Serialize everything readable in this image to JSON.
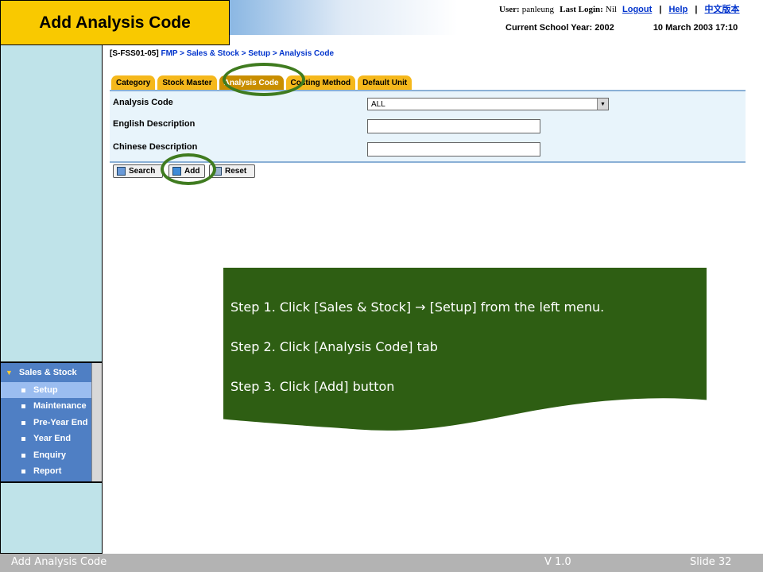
{
  "slide": {
    "title": "Add Analysis Code"
  },
  "header": {
    "user_label": "User:",
    "user_value": "panleung",
    "last_login_label": "Last Login:",
    "last_login_value": "Nil",
    "links": {
      "logout": "Logout",
      "help": "Help",
      "chinese": "中文版本"
    },
    "separator": "|",
    "school_year": "Current School Year: 2002",
    "datetime": "10 March 2003 17:10"
  },
  "breadcrumb": {
    "code": "[S-FSS01-05]",
    "trail": "FMP > Sales & Stock > Setup > Analysis Code"
  },
  "tabs": [
    {
      "label": "Category",
      "active": false
    },
    {
      "label": "Stock Master",
      "active": false
    },
    {
      "label": "Analysis Code",
      "active": true
    },
    {
      "label": "Costing Method",
      "active": false
    },
    {
      "label": "Default Unit",
      "active": false
    }
  ],
  "form": {
    "analysis_code_label": "Analysis Code",
    "analysis_code_value": "ALL",
    "english_desc_label": "English Description",
    "english_desc_value": "",
    "chinese_desc_label": "Chinese Description",
    "chinese_desc_value": ""
  },
  "buttons": {
    "search": "Search",
    "add": "Add",
    "reset": "Reset"
  },
  "sidebar": {
    "heading": "Sales & Stock",
    "items": [
      {
        "label": "Setup",
        "active": true
      },
      {
        "label": "Maintenance",
        "active": false
      },
      {
        "label": "Pre-Year End",
        "active": false
      },
      {
        "label": "Year End",
        "active": false
      },
      {
        "label": "Enquiry",
        "active": false
      },
      {
        "label": "Report",
        "active": false
      }
    ]
  },
  "callout": {
    "step1": "Step 1. Click [Sales & Stock]  → [Setup] from the left menu.",
    "step2": "Step 2. Click [Analysis Code] tab",
    "step3": "Step 3. Click [Add] button"
  },
  "footer": {
    "left": "Add Analysis Code",
    "middle": "V 1.0",
    "right": "Slide 32"
  },
  "colors": {
    "title_bg": "#f9c900",
    "callout_bg": "#2e5e13",
    "highlight_circle": "#3f7b1f",
    "menu_bg": "#4f7fc4",
    "tab_bg": "#f5b81c"
  }
}
